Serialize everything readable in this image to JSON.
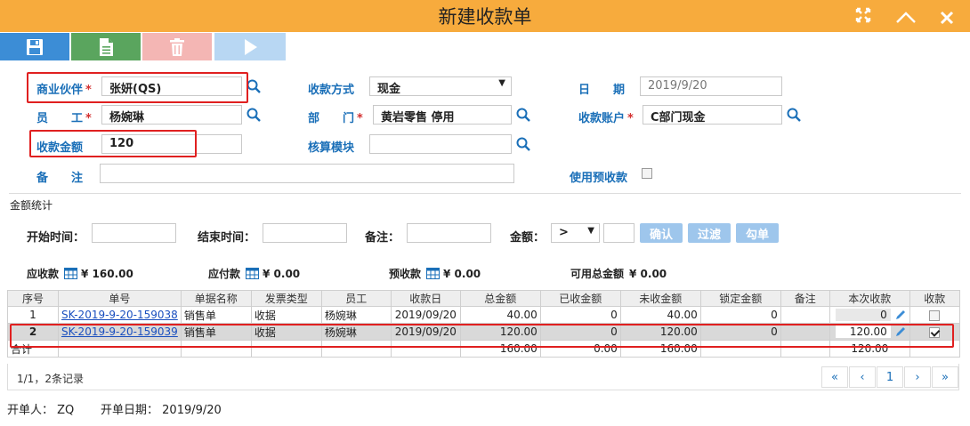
{
  "window": {
    "title": "新建收款单"
  },
  "form": {
    "partner": {
      "label": "商业伙伴",
      "value": "张妍(QS)"
    },
    "method": {
      "label": "收款方式",
      "value": "现金"
    },
    "date": {
      "label": "日　　期",
      "value": "2019/9/20"
    },
    "employee": {
      "label": "员　　工",
      "value": "杨婉琳"
    },
    "department": {
      "label": "部　　门",
      "value": "黄岩零售 停用"
    },
    "account": {
      "label": "收款账户",
      "value": "C部门现金"
    },
    "amount": {
      "label": "收款金额",
      "value": "120"
    },
    "module": {
      "label": "核算模块",
      "value": ""
    },
    "remark": {
      "label": "备　　注",
      "value": ""
    },
    "use_prepay": {
      "label": "使用预收款"
    }
  },
  "stats": {
    "section_title": "金额统计",
    "start_label": "开始时间：",
    "end_label": "结束时间：",
    "remark_label": "备注：",
    "amount_label": "金额：",
    "operator": ">",
    "btn_confirm": "确认",
    "btn_filter": "过滤",
    "btn_check": "勾单",
    "receivable_label": "应收款",
    "receivable_value": "¥ 160.00",
    "payable_label": "应付款",
    "payable_value": "¥ 0.00",
    "prepaid_label": "预收款",
    "prepaid_value": "¥ 0.00",
    "available_label": "可用总金额",
    "available_value": "¥ 0.00"
  },
  "table": {
    "headers": [
      "序号",
      "单号",
      "单据名称",
      "发票类型",
      "员工",
      "收款日",
      "总金额",
      "已收金额",
      "未收金额",
      "锁定金额",
      "备注",
      "本次收款",
      "收款"
    ],
    "rows": [
      {
        "no": "1",
        "code": "SK-2019-9-20-159038",
        "doc": "销售单",
        "invoice": "收据",
        "emp": "杨婉琳",
        "date": "2019/09/20",
        "total": "40.00",
        "received": "0",
        "unreceived": "40.00",
        "locked": "0",
        "remark": "",
        "this_amt": "0",
        "checked": false
      },
      {
        "no": "2",
        "code": "SK-2019-9-20-159039",
        "doc": "销售单",
        "invoice": "收据",
        "emp": "杨婉琳",
        "date": "2019/09/20",
        "total": "120.00",
        "received": "0",
        "unreceived": "120.00",
        "locked": "0",
        "remark": "",
        "this_amt": "120.00",
        "checked": true
      }
    ],
    "totals": {
      "label": "合计",
      "total": "160.00",
      "received": "0.00",
      "unreceived": "160.00",
      "this_amt": "120.00"
    }
  },
  "pager": {
    "info": "1/1，2条记录",
    "first": "«",
    "prev": "‹",
    "page": "1",
    "next": "›",
    "last": "»"
  },
  "footer": {
    "creator_label": "开单人：",
    "creator": "ZQ",
    "date_label": "开单日期：",
    "date": "2019/9/20"
  },
  "colors": {
    "title_bar": "#f7ab3d",
    "save": "#3c8dd6",
    "new": "#5aa55e",
    "delete": "#f4b6b4",
    "submit": "#b8d7f3",
    "label": "#1a6fb8",
    "required": "#d32f2f",
    "highlight": "#e02020"
  }
}
